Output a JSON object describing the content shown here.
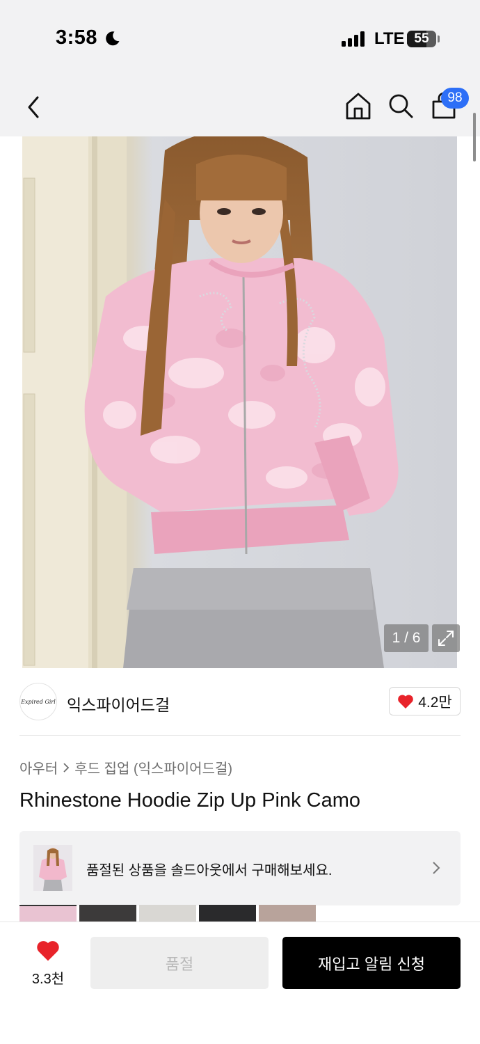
{
  "status_bar": {
    "time": "3:58",
    "network": "LTE",
    "battery": "55"
  },
  "nav": {
    "cart_count": "98"
  },
  "image": {
    "counter": "1 / 6",
    "current": 1,
    "total": 6
  },
  "brand": {
    "logo_text": "Expired Girl",
    "name": "익스파이어드걸",
    "likes": "4.2만"
  },
  "breadcrumb": {
    "category": "아우터",
    "subcategory": "후드 집업 (익스파이어드걸)"
  },
  "product": {
    "title": "Rhinestone Hoodie Zip Up Pink Camo"
  },
  "soldout_banner": {
    "text": "품절된 상품을 솔드아웃에서 구매해보세요."
  },
  "bottom_bar": {
    "likes": "3.3천",
    "soldout_label": "품절",
    "restock_label": "재입고 알림 신청"
  },
  "colors": {
    "accent_blue": "#2d6ff7",
    "heart_red": "#e8232a",
    "primary_button": "#000000",
    "disabled_button": "#eeeeee"
  }
}
